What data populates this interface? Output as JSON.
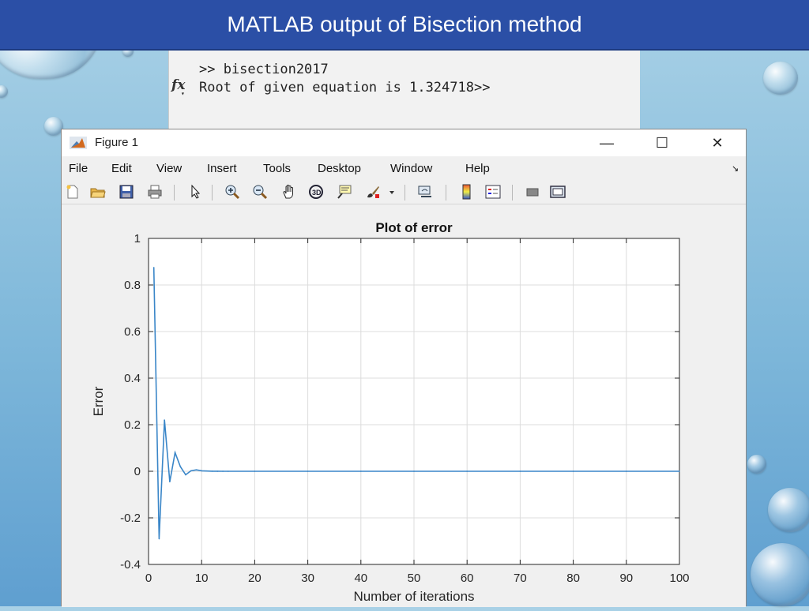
{
  "slide": {
    "title": "MATLAB output of Bisection method"
  },
  "console": {
    "line1": ">> bisection2017",
    "line2": "Root of given equation is 1.324718>>",
    "fx_label": "fx"
  },
  "figure_window": {
    "title": "Figure 1",
    "controls": {
      "minimize": "—",
      "maximize": "☐",
      "close": "✕"
    },
    "menu": [
      "File",
      "Edit",
      "View",
      "Insert",
      "Tools",
      "Desktop",
      "Window",
      "Help"
    ],
    "menu_arrow": "↘",
    "toolbar_icons": [
      "new-figure-icon",
      "open-file-icon",
      "save-icon",
      "print-icon",
      "edit-plot-arrow-icon",
      "zoom-in-icon",
      "zoom-out-icon",
      "pan-hand-icon",
      "rotate-3d-icon",
      "data-cursor-icon",
      "brush-icon",
      "brush-dropdown-icon",
      "link-plot-icon",
      "colorbar-icon",
      "legend-icon",
      "hide-plot-tools-icon",
      "show-plot-tools-icon"
    ]
  },
  "chart_data": {
    "type": "line",
    "title": "Plot of error",
    "xlabel": "Number of iterations",
    "ylabel": "Error",
    "xlim": [
      0,
      100
    ],
    "ylim": [
      -0.4,
      1
    ],
    "xticks": [
      0,
      10,
      20,
      30,
      40,
      50,
      60,
      70,
      80,
      90,
      100
    ],
    "yticks": [
      -0.4,
      -0.2,
      0,
      0.2,
      0.4,
      0.6,
      0.8,
      1
    ],
    "ytick_labels": [
      "-0.4",
      "-0.2",
      "0",
      "0.2",
      "0.4",
      "0.6",
      "0.8",
      "1"
    ],
    "grid": true,
    "line_color": "#3a86c8",
    "series": [
      {
        "x": [
          1,
          2,
          3,
          4,
          5,
          6,
          7,
          8,
          9,
          10,
          11,
          12,
          13,
          14,
          15,
          20,
          30,
          40,
          50,
          60,
          70,
          80,
          90,
          100
        ],
        "values": [
          0.875,
          -0.29,
          0.22,
          -0.045,
          0.08,
          0.02,
          -0.015,
          0.002,
          0.006,
          0.002,
          0.001,
          0.0005,
          0.0002,
          0.0001,
          0,
          0,
          0,
          0,
          0,
          0,
          0,
          0,
          0,
          0
        ]
      }
    ]
  }
}
